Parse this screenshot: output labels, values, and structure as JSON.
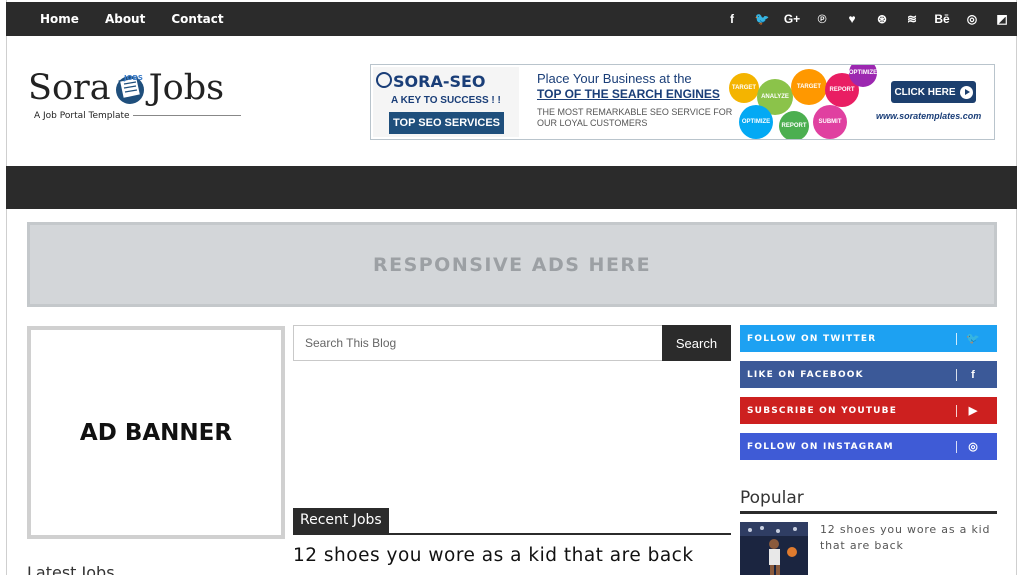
{
  "topnav": {
    "links": [
      "Home",
      "About",
      "Contact"
    ]
  },
  "social_icons": [
    "facebook-icon",
    "twitter-icon",
    "google-plus-icon",
    "pinterest-icon",
    "heart-icon",
    "dribbble-icon",
    "rss-icon",
    "behance-icon",
    "instagram-icon",
    "delicious-icon"
  ],
  "social_glyphs": [
    "f",
    "🐦",
    "G+",
    "℗",
    "♥",
    "⊛",
    "≋",
    "Bē",
    "◎",
    "◩"
  ],
  "logo": {
    "part1": "Sora",
    "part2": "Jobs",
    "tagline": "A Job Portal Template"
  },
  "banner": {
    "title": "SORA-SEO",
    "subtitle": "A KEY TO SUCCESS ! !",
    "button": "TOP SEO SERVICES",
    "line1": "Place Your Business at the",
    "line2": "TOP OF THE SEARCH ENGINES",
    "line3a": "THE MOST REMARKABLE SEO SERVICE FOR",
    "line3b": "OUR LOYAL CUSTOMERS",
    "circles": [
      "TARGET",
      "ANALYZE",
      "TARGET",
      "REPORT",
      "OPTIMIZE",
      "REPORT",
      "SUBMIT",
      "OPTIMIZE"
    ],
    "click": "CLICK HERE",
    "url": "www.soratemplates.com"
  },
  "ads": {
    "label": "RESPONSIVE ADS HERE"
  },
  "ad_banner": {
    "label": "AD BANNER"
  },
  "latest_jobs": "Latest Jobs",
  "search": {
    "placeholder": "Search This Blog",
    "button": "Search"
  },
  "recent": {
    "heading": "Recent Jobs",
    "post_title": "12 shoes you wore as a kid that are back"
  },
  "follow": [
    {
      "label": "FOLLOW ON TWITTER",
      "icon": "twitter-icon",
      "glyph": "🐦",
      "color": "#1da1f2"
    },
    {
      "label": "LIKE ON FACEBOOK",
      "icon": "facebook-icon",
      "glyph": "f",
      "color": "#3b5998"
    },
    {
      "label": "SUBSCRIBE ON YOUTUBE",
      "icon": "youtube-icon",
      "glyph": "▶",
      "color": "#cd201f"
    },
    {
      "label": "FOLLOW ON INSTAGRAM",
      "icon": "instagram-icon",
      "glyph": "◎",
      "color": "#3f5bd6"
    }
  ],
  "popular": {
    "title": "Popular",
    "item": "12 shoes you wore as a kid that are back"
  },
  "colors": {
    "dark_bar": "#2b2b2b",
    "ads_bg": "#d3d6d9"
  }
}
